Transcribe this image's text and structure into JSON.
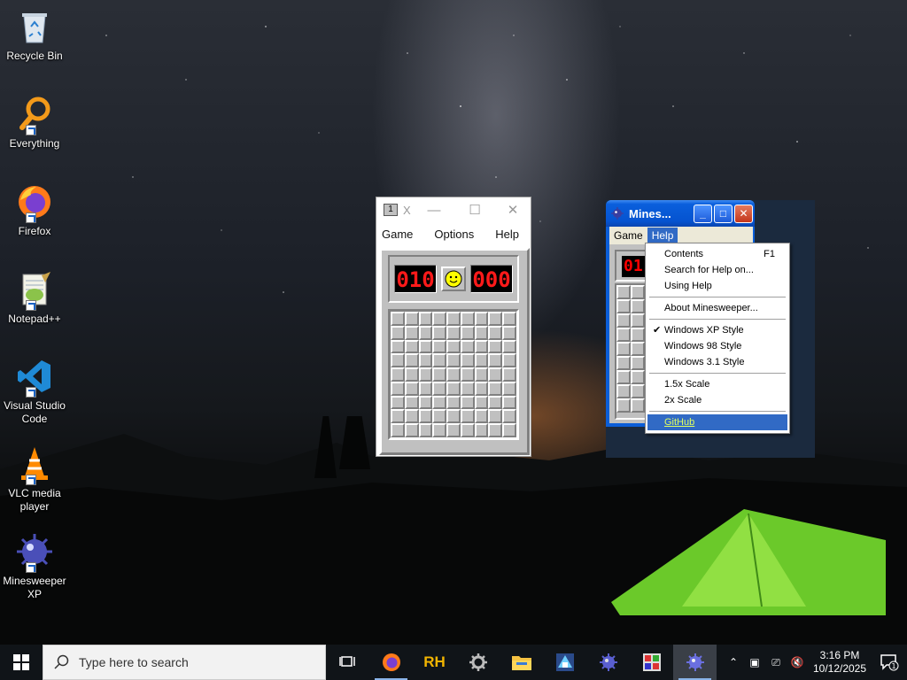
{
  "desktop_icons": [
    {
      "label": "Recycle Bin"
    },
    {
      "label": "Everything"
    },
    {
      "label": "Firefox"
    },
    {
      "label": "Notepad++"
    },
    {
      "label": "Visual Studio Code"
    },
    {
      "label": "VLC media player"
    },
    {
      "label": "Minesweeper XP"
    }
  ],
  "win10_minesweeper": {
    "title": "X",
    "menu": [
      "Game",
      "Options",
      "Help"
    ],
    "mine_counter": "010",
    "timer": "000",
    "grid": {
      "rows": 9,
      "cols": 9
    }
  },
  "xp_minesweeper": {
    "title": "Mines...",
    "menu": [
      "Game",
      "Help"
    ],
    "open_menu": "Help",
    "counter_partial": "01"
  },
  "help_menu": {
    "items": [
      {
        "label": "Contents",
        "shortcut": "F1"
      },
      {
        "label": "Search for Help on...",
        "shortcut": ""
      },
      {
        "label": "Using Help",
        "shortcut": ""
      },
      {
        "label": "About Minesweeper...",
        "shortcut": ""
      },
      {
        "label": "Windows XP Style",
        "shortcut": "",
        "checked": true
      },
      {
        "label": "Windows 98 Style",
        "shortcut": ""
      },
      {
        "label": "Windows 3.1 Style",
        "shortcut": ""
      },
      {
        "label": "1.5x Scale",
        "shortcut": ""
      },
      {
        "label": "2x Scale",
        "shortcut": ""
      },
      {
        "label": "GitHub",
        "shortcut": "",
        "highlighted": true
      }
    ]
  },
  "taskbar": {
    "search_placeholder": "Type here to search",
    "pinned": [
      "task-view",
      "firefox",
      "rh",
      "settings",
      "file-explorer",
      "app-blocks",
      "minesweeper",
      "app-tiles",
      "minesweeper-xp"
    ],
    "time": "3:16 PM",
    "date": "10/12/2025",
    "notification_count": "1"
  },
  "colors": {
    "xp_title": "#0553d0",
    "menu_highlight": "#316ac5",
    "led_red": "#ff1a1a",
    "taskbar": "#101418"
  }
}
